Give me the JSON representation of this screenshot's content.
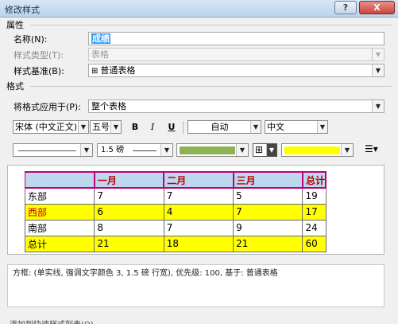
{
  "dialog": {
    "title": "修改样式",
    "help_button": "?",
    "close_button": "X"
  },
  "properties": {
    "section_label": "属性",
    "name_label": "名称(N):",
    "name_value": "成绩",
    "style_type_label": "样式类型(T):",
    "style_type_value": "表格",
    "style_base_label": "样式基准(B):",
    "style_base_value": "普通表格"
  },
  "format": {
    "section_label": "格式",
    "apply_to_label": "将格式应用于(P):",
    "apply_to_value": "整个表格",
    "font_name": "宋体 (中文正文)",
    "font_size": "五号",
    "bold": "B",
    "italic": "I",
    "underline": "U",
    "font_color": "自动",
    "script": "中文",
    "line_weight": "1.5 磅",
    "line_color": "#8db256",
    "fill_color": "#ffff00"
  },
  "preview": {
    "header": [
      "",
      "一月",
      "二月",
      "三月",
      "总计"
    ],
    "rows": [
      [
        "东部",
        "7",
        "7",
        "5",
        "19"
      ],
      [
        "西部",
        "6",
        "4",
        "7",
        "17"
      ],
      [
        "南部",
        "8",
        "7",
        "9",
        "24"
      ],
      [
        "总计",
        "21",
        "18",
        "21",
        "60"
      ]
    ]
  },
  "description": "方框: (单实线, 强调文字颜色 3, 1.5 磅 行宽), 优先级: 100, 基于: 普通表格",
  "bottom_partial_text": "添加到快速样式列表(Q)"
}
